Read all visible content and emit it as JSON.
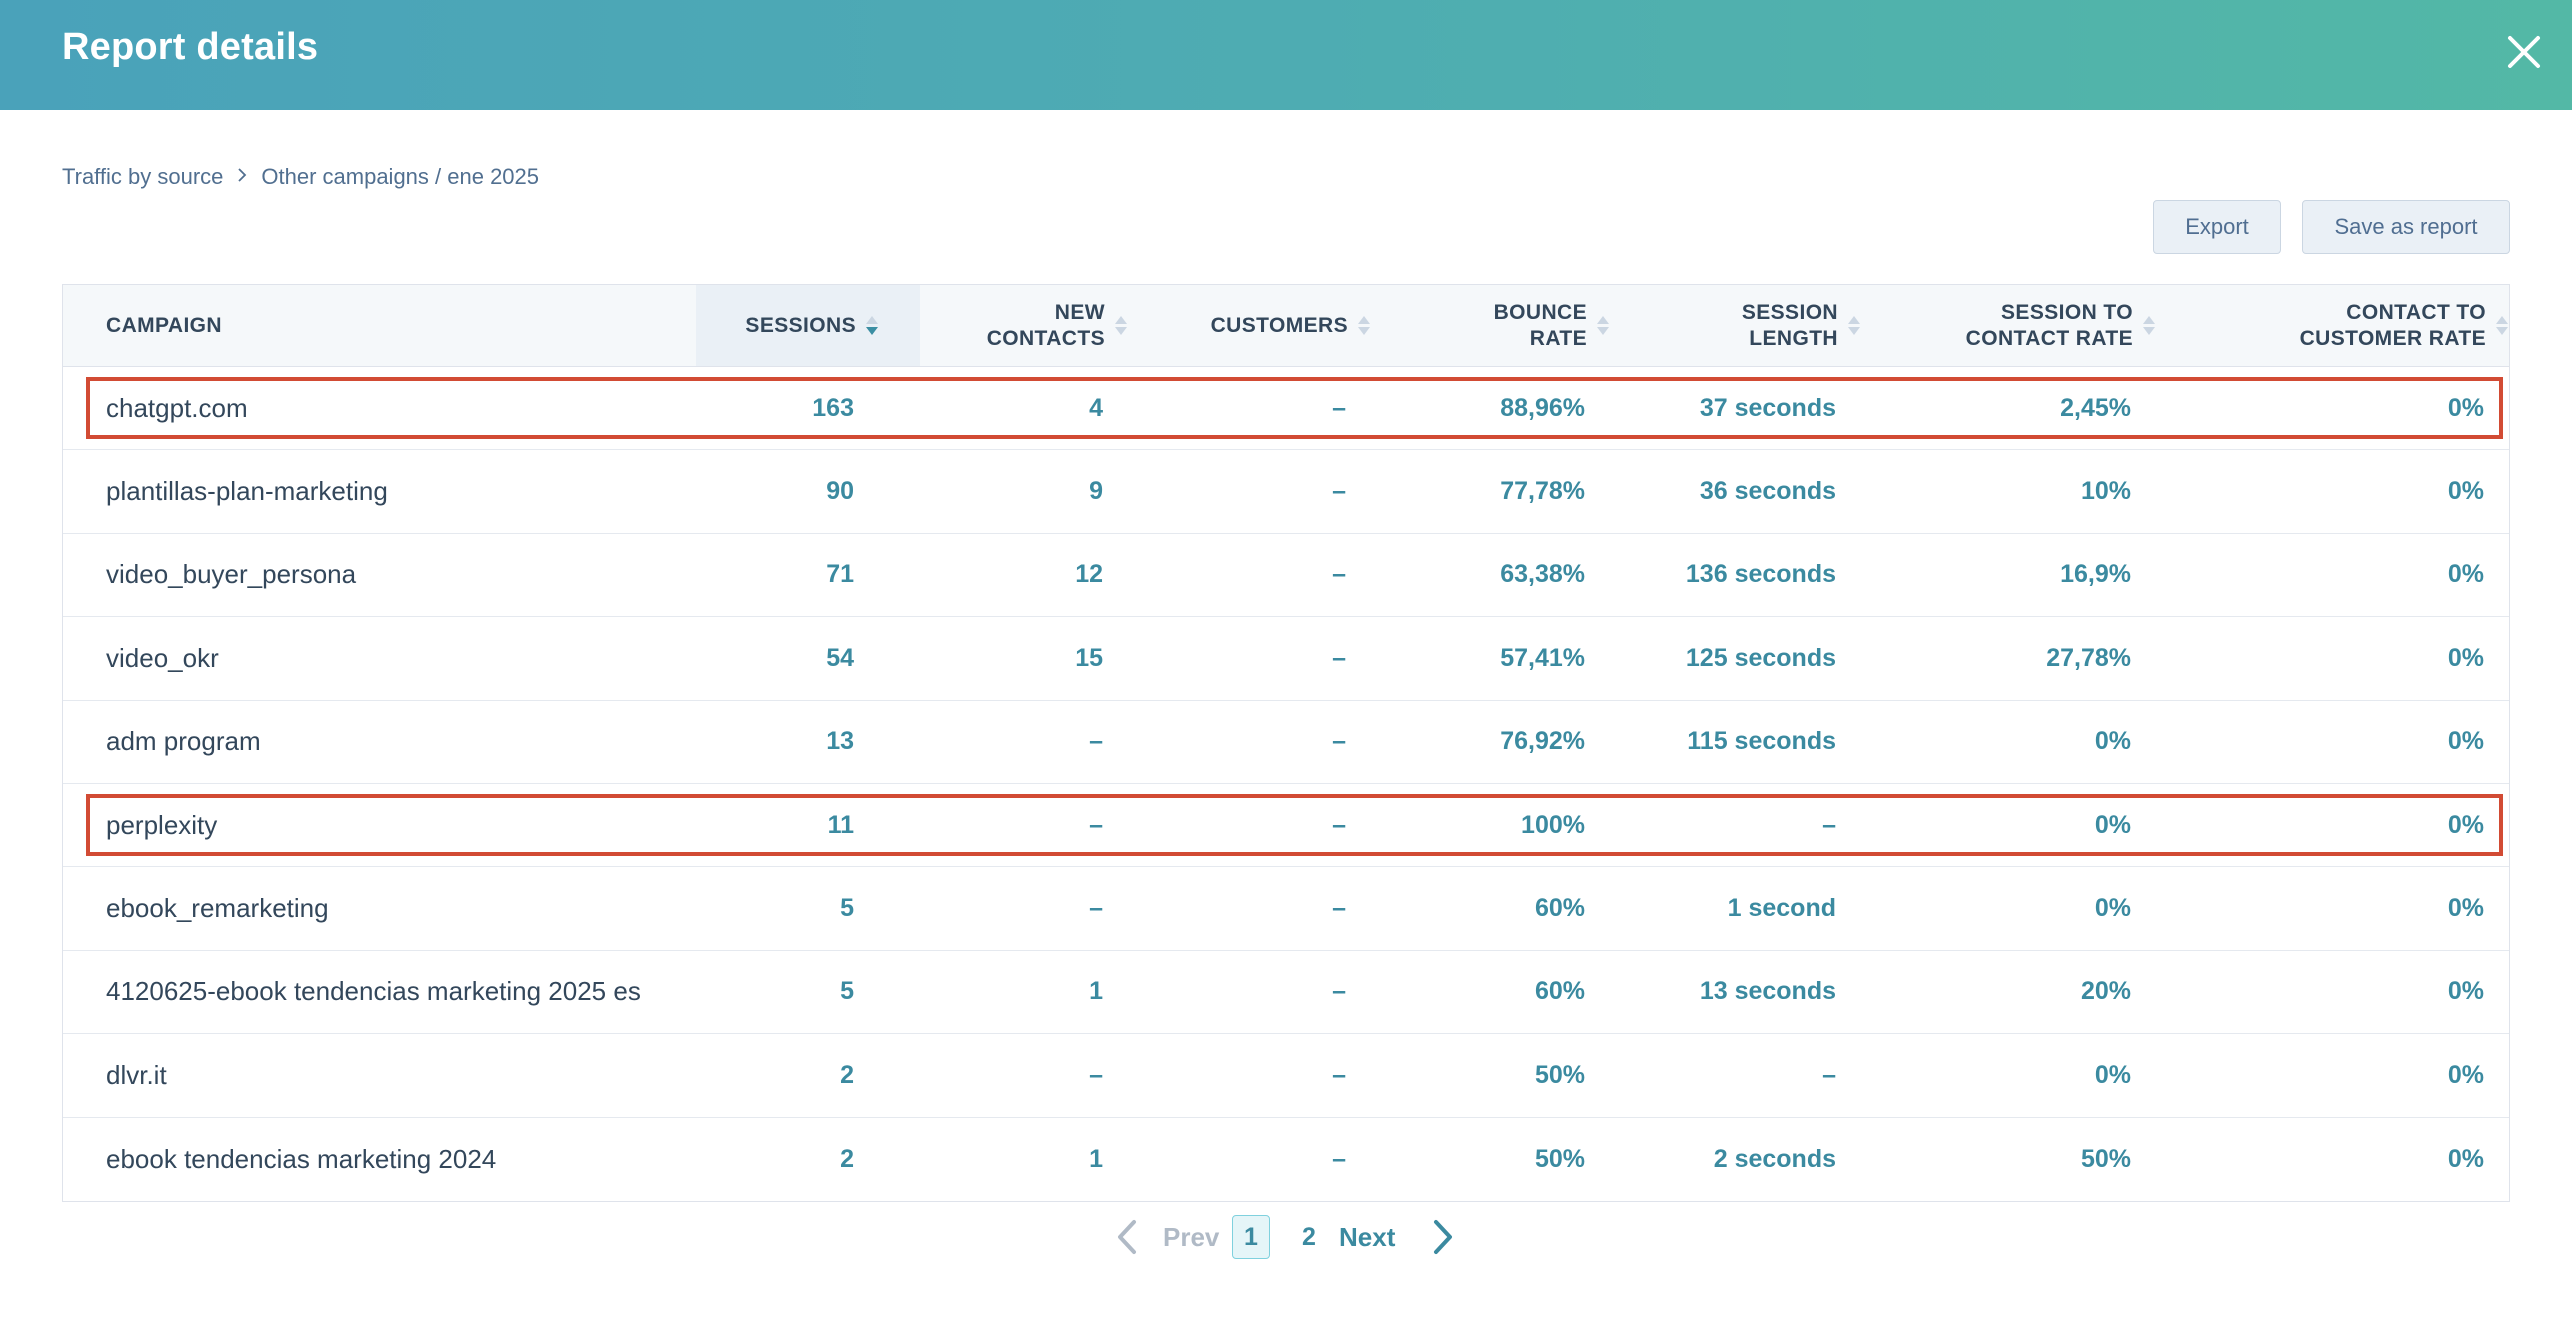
{
  "header": {
    "title": "Report details",
    "close_icon": "close-icon"
  },
  "breadcrumb": {
    "items": [
      "Traffic by source",
      "Other campaigns / ene 2025"
    ],
    "separator_icon": "chevron-right-icon"
  },
  "toolbar": {
    "export_label": "Export",
    "save_label": "Save as report"
  },
  "table": {
    "columns": [
      {
        "key": "campaign",
        "label": "CAMPAIGN",
        "sortable": false
      },
      {
        "key": "sessions",
        "label": "SESSIONS",
        "sortable": true,
        "sort": "desc"
      },
      {
        "key": "new_contacts",
        "label": "NEW CONTACTS",
        "line1": "NEW",
        "line2": "CONTACTS",
        "sortable": true
      },
      {
        "key": "customers",
        "label": "CUSTOMERS",
        "sortable": true
      },
      {
        "key": "bounce_rate",
        "label": "BOUNCE RATE",
        "line1": "BOUNCE",
        "line2": "RATE",
        "sortable": true
      },
      {
        "key": "session_length",
        "label": "SESSION LENGTH",
        "line1": "SESSION",
        "line2": "LENGTH",
        "sortable": true
      },
      {
        "key": "session_to_contact_rate",
        "label": "SESSION TO CONTACT RATE",
        "line1": "SESSION TO",
        "line2": "CONTACT RATE",
        "sortable": true
      },
      {
        "key": "contact_to_customer_rate",
        "label": "CONTACT TO CUSTOMER RATE",
        "line1": "CONTACT TO",
        "line2": "CUSTOMER RATE",
        "sortable": true
      }
    ],
    "rows": [
      {
        "campaign": "chatgpt.com",
        "sessions": "163",
        "new_contacts": "4",
        "customers": "–",
        "bounce_rate": "88,96%",
        "session_length": "37 seconds",
        "session_to_contact_rate": "2,45%",
        "contact_to_customer_rate": "0%",
        "highlighted": true
      },
      {
        "campaign": "plantillas-plan-marketing",
        "sessions": "90",
        "new_contacts": "9",
        "customers": "–",
        "bounce_rate": "77,78%",
        "session_length": "36 seconds",
        "session_to_contact_rate": "10%",
        "contact_to_customer_rate": "0%",
        "highlighted": false
      },
      {
        "campaign": "video_buyer_persona",
        "sessions": "71",
        "new_contacts": "12",
        "customers": "–",
        "bounce_rate": "63,38%",
        "session_length": "136 seconds",
        "session_to_contact_rate": "16,9%",
        "contact_to_customer_rate": "0%",
        "highlighted": false
      },
      {
        "campaign": "video_okr",
        "sessions": "54",
        "new_contacts": "15",
        "customers": "–",
        "bounce_rate": "57,41%",
        "session_length": "125 seconds",
        "session_to_contact_rate": "27,78%",
        "contact_to_customer_rate": "0%",
        "highlighted": false
      },
      {
        "campaign": "adm program",
        "sessions": "13",
        "new_contacts": "–",
        "customers": "–",
        "bounce_rate": "76,92%",
        "session_length": "115 seconds",
        "session_to_contact_rate": "0%",
        "contact_to_customer_rate": "0%",
        "highlighted": false
      },
      {
        "campaign": "perplexity",
        "sessions": "11",
        "new_contacts": "–",
        "customers": "–",
        "bounce_rate": "100%",
        "session_length": "–",
        "session_to_contact_rate": "0%",
        "contact_to_customer_rate": "0%",
        "highlighted": true
      },
      {
        "campaign": "ebook_remarketing",
        "sessions": "5",
        "new_contacts": "–",
        "customers": "–",
        "bounce_rate": "60%",
        "session_length": "1 second",
        "session_to_contact_rate": "0%",
        "contact_to_customer_rate": "0%",
        "highlighted": false
      },
      {
        "campaign": "4120625-ebook tendencias marketing 2025 es",
        "sessions": "5",
        "new_contacts": "1",
        "customers": "–",
        "bounce_rate": "60%",
        "session_length": "13 seconds",
        "session_to_contact_rate": "20%",
        "contact_to_customer_rate": "0%",
        "highlighted": false
      },
      {
        "campaign": "dlvr.it",
        "sessions": "2",
        "new_contacts": "–",
        "customers": "–",
        "bounce_rate": "50%",
        "session_length": "–",
        "session_to_contact_rate": "0%",
        "contact_to_customer_rate": "0%",
        "highlighted": false
      },
      {
        "campaign": "ebook tendencias marketing 2024",
        "sessions": "2",
        "new_contacts": "1",
        "customers": "–",
        "bounce_rate": "50%",
        "session_length": "2 seconds",
        "session_to_contact_rate": "50%",
        "contact_to_customer_rate": "0%",
        "highlighted": false
      }
    ]
  },
  "pagination": {
    "prev_label": "Prev",
    "next_label": "Next",
    "pages": [
      "1",
      "2"
    ],
    "current_page": "1"
  },
  "colors": {
    "header_gradient_start": "#4aa2ba",
    "header_gradient_end": "#53b8a6",
    "value_teal": "#3b8aa0",
    "highlight_red": "#d24b34"
  }
}
